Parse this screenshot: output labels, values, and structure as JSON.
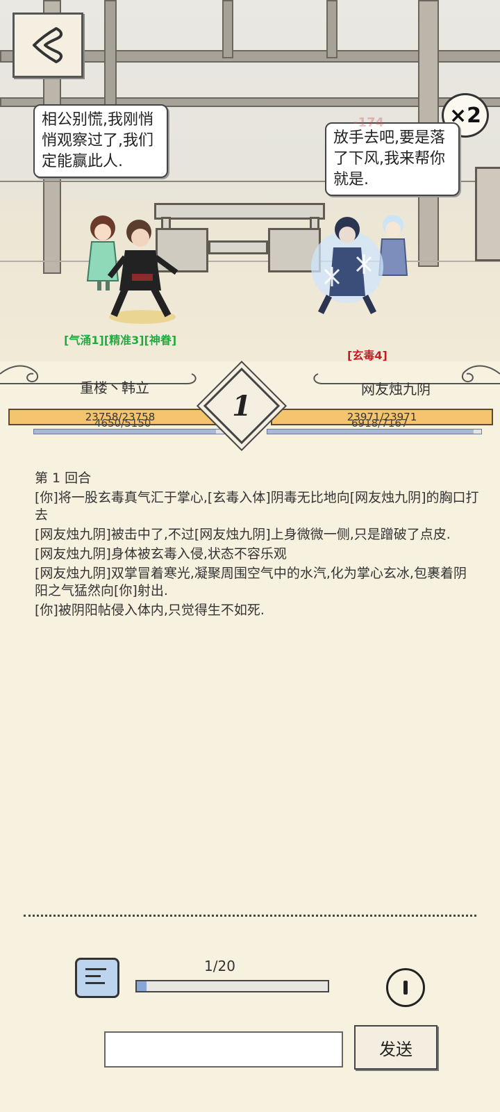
{
  "scene": {
    "speed_multiplier": "×2",
    "left_bubble": "相公别慌,我刚悄悄观察过了,我们定能赢此人.",
    "right_bubble": "放手去吧,要是落了下风,我来帮你就是.",
    "damage_text": "-174",
    "left_status_tags": "[气涌1][精准3][神眷]",
    "right_status_tags": "[玄毒4]"
  },
  "battle": {
    "left_name": "重楼丶韩立",
    "right_name": "网友烛九阴",
    "round_number": "1",
    "left_hp": "23758/23758",
    "left_hp_ratio": 1.0,
    "left_mp": "4650/5150",
    "left_mp_ratio": 0.903,
    "right_hp": "23971/23971",
    "right_hp_ratio": 1.0,
    "right_mp": "6918/7167",
    "right_mp_ratio": 0.965
  },
  "log": {
    "round_title": "第 1 回合",
    "lines": [
      "[你]将一股玄毒真气汇于掌心,[玄毒入体]阴毒无比地向[网友烛九阴]的胸口打去",
      "[网友烛九阴]被击中了,不过[网友烛九阴]上身微微一侧,只是蹭破了点皮.",
      "[网友烛九阴]身体被玄毒入侵,状态不容乐观",
      "[网友烛九阴]双掌冒着寒光,凝聚周围空气中的水汽,化为掌心玄冰,包裹着阴阳之气猛然向[你]射出.",
      "[你]被阴阳帖侵入体内,只觉得生不如死."
    ]
  },
  "controls": {
    "progress_label": "1/20",
    "progress_ratio": 0.05,
    "send_label": "发送",
    "chat_input_value": "",
    "icons": {
      "back": "back-arrow-icon",
      "chat": "chat-log-icon",
      "pause": "pause-icon"
    }
  },
  "colors": {
    "hp": "#f4c46e",
    "mp": "#a9b9d3",
    "buff_green": "#23a83a",
    "debuff_red": "#c8191a",
    "background": "#f7f1df"
  }
}
